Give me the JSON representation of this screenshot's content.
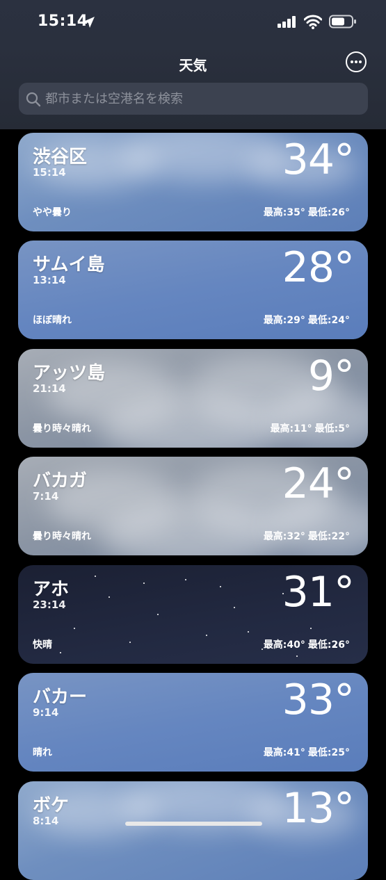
{
  "status": {
    "time": "15:14"
  },
  "header": {
    "title": "天気",
    "search_placeholder": "都市または空港名を検索"
  },
  "cities": [
    {
      "name": "渋谷区",
      "time": "15:14",
      "temp": "34°",
      "condition": "やや曇り",
      "high": "最高:35°",
      "low": "最低:26°",
      "theme": "cloudy-day"
    },
    {
      "name": "サムイ島",
      "time": "13:14",
      "temp": "28°",
      "condition": "ほぼ晴れ",
      "high": "最高:29°",
      "low": "最低:24°",
      "theme": "clear-day"
    },
    {
      "name": "アッツ島",
      "time": "21:14",
      "temp": "9°",
      "condition": "曇り時々晴れ",
      "high": "最高:11°",
      "low": "最低:5°",
      "theme": "overcast"
    },
    {
      "name": "バカガ",
      "time": "7:14",
      "temp": "24°",
      "condition": "曇り時々晴れ",
      "high": "最高:32°",
      "low": "最低:22°",
      "theme": "overcast"
    },
    {
      "name": "アホ",
      "time": "23:14",
      "temp": "31°",
      "condition": "快晴",
      "high": "最高:40°",
      "low": "最低:26°",
      "theme": "clear-night"
    },
    {
      "name": "バカー",
      "time": "9:14",
      "temp": "33°",
      "condition": "晴れ",
      "high": "最高:41°",
      "low": "最低:25°",
      "theme": "clear-day"
    },
    {
      "name": "ボケ",
      "time": "8:14",
      "temp": "13°",
      "condition": "",
      "high": "",
      "low": "",
      "theme": "cloudy-day"
    }
  ],
  "colors": {
    "cloudy-day": "#6d8fbd",
    "clear-day": "#5f84c1",
    "overcast": "#8e97a4",
    "clear-night": "#1e2438"
  }
}
